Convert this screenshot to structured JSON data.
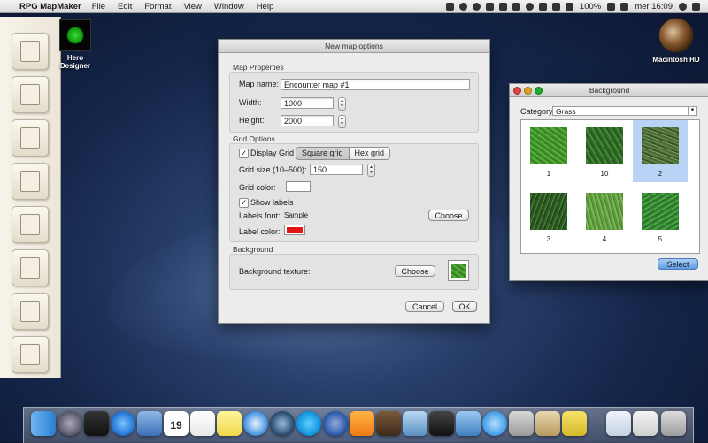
{
  "menubar": {
    "app_name": "RPG MapMaker",
    "items": [
      "File",
      "Edit",
      "Format",
      "View",
      "Window",
      "Help"
    ],
    "battery": "100%",
    "clock": "mer 16:09"
  },
  "desktop": {
    "hero_designer_line1": "Hero",
    "hero_designer_line2": "Designer",
    "hd_label": "Macintosh HD"
  },
  "new_map_dialog": {
    "title": "New map options",
    "map_properties": {
      "section_label": "Map Properties",
      "map_name_label": "Map name:",
      "map_name_value": "Encounter map #1",
      "width_label": "Width:",
      "width_value": "1000",
      "height_label": "Height:",
      "height_value": "2000"
    },
    "grid_options": {
      "section_label": "Grid Options",
      "display_grid_label": "Display Grid",
      "display_grid_checked": true,
      "square_grid_label": "Square grid",
      "hex_grid_label": "Hex grid",
      "selected_grid": "Square grid",
      "grid_size_label": "Grid size (10–500):",
      "grid_size_value": "150",
      "grid_color_label": "Grid color:",
      "grid_color": "#ffffff",
      "show_labels_label": "Show labels",
      "show_labels_checked": true,
      "labels_font_label": "Labels font:",
      "labels_font_value": "Sample",
      "choose_font_label": "Choose",
      "label_color_label": "Label color:",
      "label_color": "#e31414"
    },
    "background": {
      "section_label": "Background",
      "texture_label": "Background texture:",
      "choose_label": "Choose"
    },
    "cancel_label": "Cancel",
    "ok_label": "OK"
  },
  "background_window": {
    "title": "Background",
    "category_label": "Category:",
    "category_value": "Grass",
    "tiles": [
      {
        "label": "1",
        "texture": "g-bright",
        "selected": false
      },
      {
        "label": "10",
        "texture": "g-dark",
        "selected": false
      },
      {
        "label": "2",
        "texture": "g-mixed",
        "selected": true
      },
      {
        "label": "3",
        "texture": "g-dense",
        "selected": false
      },
      {
        "label": "4",
        "texture": "g-light",
        "selected": false
      },
      {
        "label": "5",
        "texture": "g-lush",
        "selected": false
      }
    ],
    "select_label": "Select"
  },
  "dock": {
    "date_number": "19",
    "apps": [
      "finder",
      "launchpad",
      "mission-control",
      "app-store",
      "preview",
      "calendar",
      "reminders",
      "stickies",
      "safari",
      "quicktime",
      "skype",
      "itunes",
      "vlc",
      "photo-booth",
      "iphoto",
      "terminal",
      "xcode",
      "messages",
      "mail",
      "scrapbook",
      "folder",
      "trash"
    ]
  }
}
